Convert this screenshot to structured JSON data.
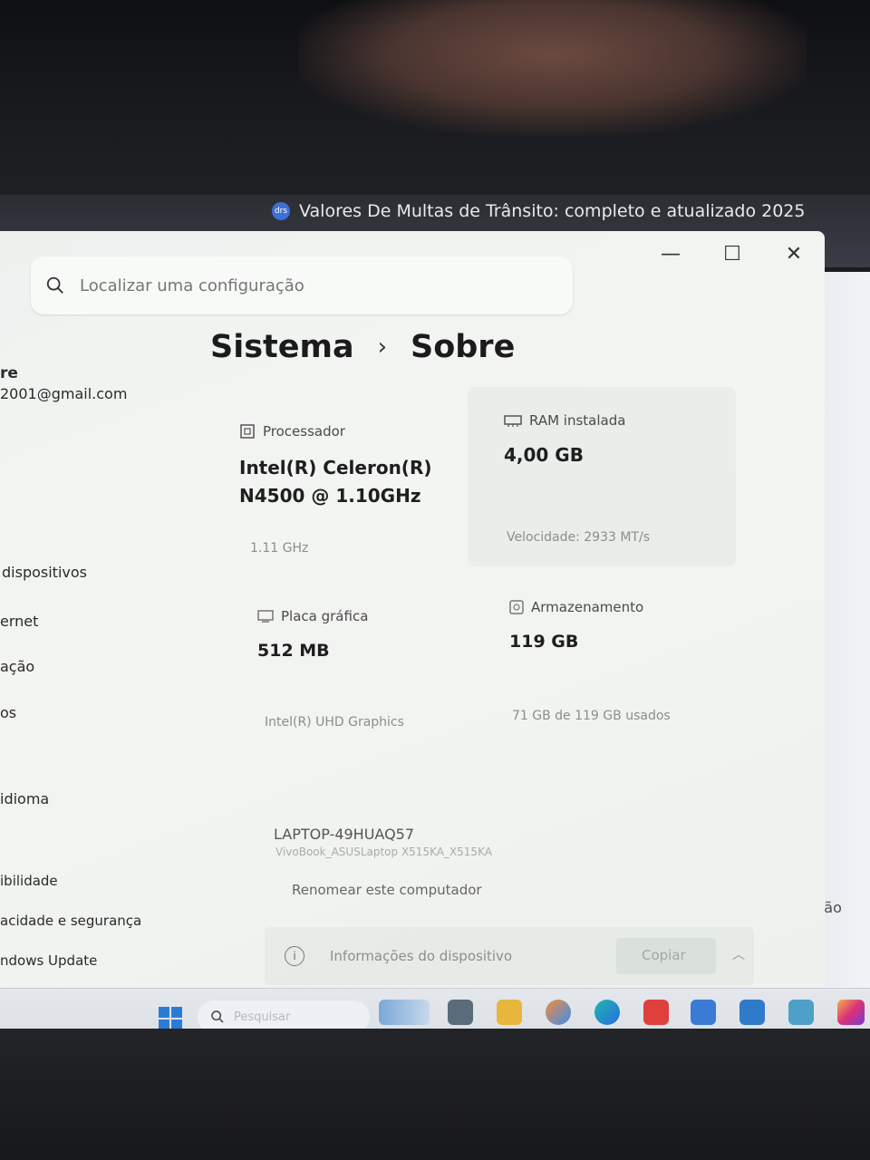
{
  "browser": {
    "tab_title": "Valores De Multas de Trânsito: completo e atualizado 2025",
    "favicon_text": "drs"
  },
  "window_controls": {
    "minimize": "—",
    "maximize": "☐",
    "close": "✕"
  },
  "search": {
    "placeholder": "Localizar uma configuração"
  },
  "breadcrumb": {
    "parent": "Sistema",
    "current": "Sobre"
  },
  "sidebar": {
    "user_name": "re",
    "user_email": "2001@gmail.com",
    "items": [
      "dispositivos",
      "ernet",
      "ação",
      "os",
      "idioma",
      "ibilidade",
      "acidade e segurança",
      "ndows Update"
    ]
  },
  "specs": {
    "processor": {
      "label": "Processador",
      "value_line1": "Intel(R) Celeron(R)",
      "value_line2": "N4500 @ 1.10GHz",
      "sub": "1.11 GHz"
    },
    "ram": {
      "label": "RAM instalada",
      "value": "4,00 GB",
      "sub": "Velocidade: 2933 MT/s"
    },
    "gpu": {
      "label": "Placa gráfica",
      "value": "512 MB",
      "sub": "Intel(R) UHD Graphics"
    },
    "storage": {
      "label": "Armazenamento",
      "value": "119 GB",
      "sub": "71 GB de 119 GB usados"
    }
  },
  "device": {
    "name": "LAPTOP-49HUAQ57",
    "model": "VivoBook_ASUSLaptop X515KA_X515KA",
    "rename_link": "Renomear este computador"
  },
  "device_info": {
    "label": "Informações do dispositivo",
    "copy_button": "Copiar"
  },
  "background_page": {
    "partial_text": "nissão"
  },
  "taskbar": {
    "search_placeholder": "Pesquisar"
  }
}
